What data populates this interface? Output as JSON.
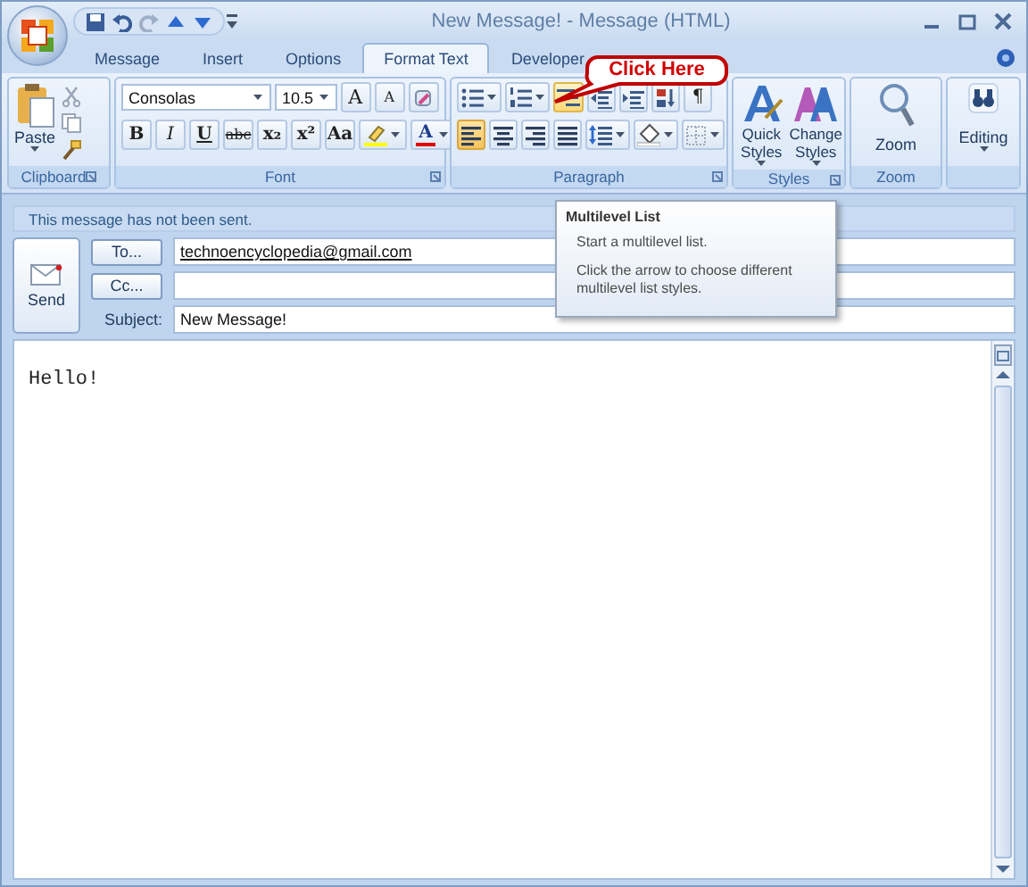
{
  "window": {
    "title": "New Message! - Message (HTML)"
  },
  "tabs": [
    {
      "label": "Message",
      "selected": false
    },
    {
      "label": "Insert",
      "selected": false
    },
    {
      "label": "Options",
      "selected": false
    },
    {
      "label": "Format Text",
      "selected": true
    },
    {
      "label": "Developer",
      "selected": false
    }
  ],
  "ribbon": {
    "clipboard": {
      "label": "Clipboard",
      "paste": "Paste"
    },
    "font": {
      "label": "Font",
      "font_name": "Consolas",
      "font_size": "10.5",
      "size_buttons": [
        "A",
        "A"
      ],
      "format_buttons": [
        "B",
        "I",
        "U",
        "abc",
        "x₂",
        "x²",
        "Aa"
      ],
      "font_color": "A"
    },
    "paragraph": {
      "label": "Paragraph",
      "multilevel_hover": true,
      "show_marks": "¶",
      "alignment": [
        {
          "selected": true
        },
        {
          "selected": false
        },
        {
          "selected": false
        },
        {
          "selected": false
        }
      ]
    },
    "styles": {
      "label": "Styles",
      "buttons": [
        "Quick Styles",
        "Change Styles"
      ]
    },
    "zoom": {
      "label": "Zoom",
      "button": "Zoom"
    },
    "editing": {
      "button": "Editing"
    }
  },
  "callout": "Click Here",
  "tooltip": {
    "title": "Multilevel List",
    "lines": [
      "Start a multilevel list.",
      "Click the arrow to choose different multilevel list styles."
    ]
  },
  "info_bar": "This message has not been sent.",
  "send": "Send",
  "to": {
    "button": "To...",
    "value": "technoencyclopedia@gmail.com"
  },
  "cc": {
    "button": "Cc..."
  },
  "subject": {
    "label": "Subject:",
    "value": "New Message!"
  },
  "body": "Hello!"
}
